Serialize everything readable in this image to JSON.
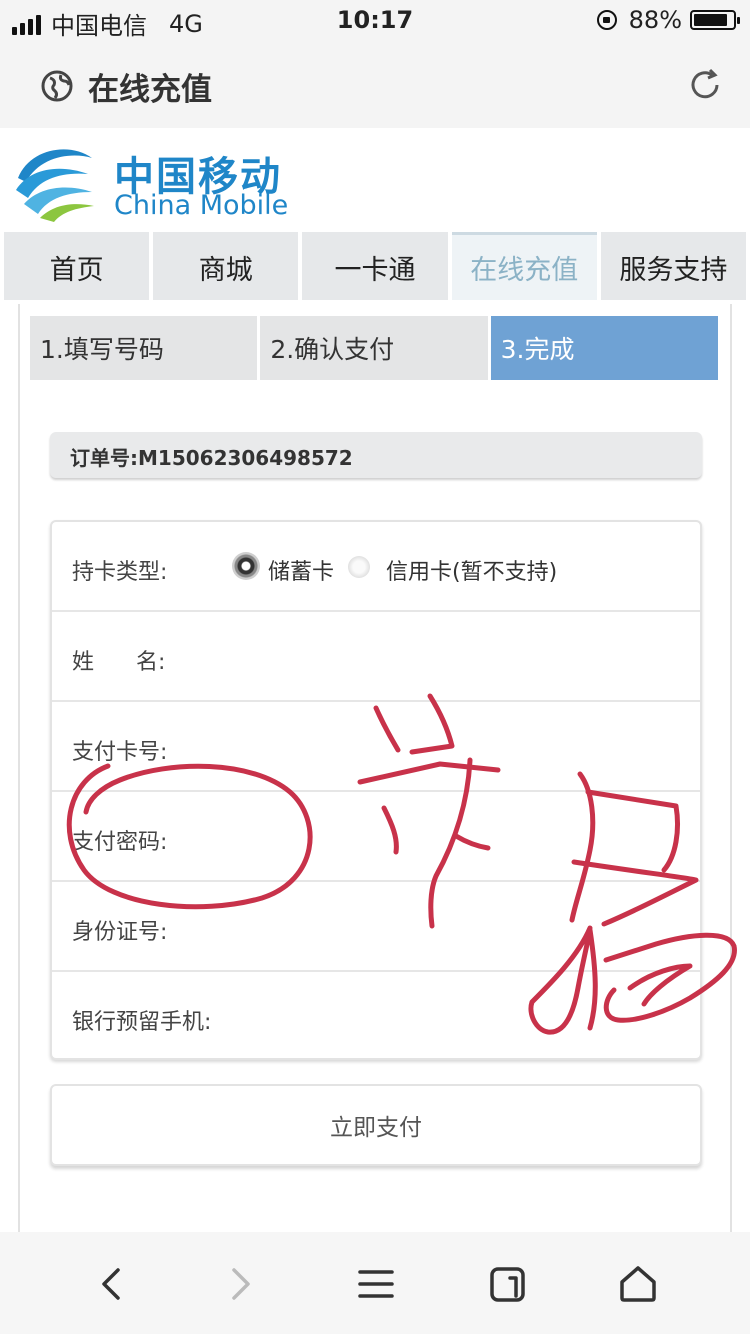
{
  "status_bar": {
    "carrier": "中国电信",
    "network": "4G",
    "time": "10:17",
    "battery": "88%",
    "battery_level": 0.88
  },
  "browser": {
    "title": "在线充值",
    "icons": [
      "globe-icon",
      "reload-icon"
    ]
  },
  "logo": {
    "cn": "中国移动",
    "en": "China Mobile",
    "color": "#1f86c8"
  },
  "nav": {
    "tabs": [
      "首页",
      "商城",
      "一卡通",
      "在线充值",
      "服务支持"
    ],
    "active": "在线充值"
  },
  "steps": {
    "items": [
      "1.填写号码",
      "2.确认支付",
      "3.完成"
    ],
    "active": "3.完成",
    "active_color": "#6fa2d4"
  },
  "order": {
    "label": "订单号:M15062306498572"
  },
  "form": {
    "card_type_label": "持卡类型:",
    "card_type_options": [
      "储蓄卡",
      "信用卡(暂不支持)"
    ],
    "card_type_selected": "储蓄卡",
    "name_label": "姓      名:",
    "card_no_label": "支付卡号:",
    "password_label": "支付密码:",
    "id_label": "身份证号:",
    "phone_label": "银行预留手机:"
  },
  "pay_button": {
    "label": "立即支付"
  },
  "annotation": {
    "description_color": "#c8324a"
  },
  "toolbar": {
    "icons": [
      "back-icon",
      "forward-icon",
      "menu-icon",
      "tabs-icon",
      "home-icon"
    ]
  }
}
